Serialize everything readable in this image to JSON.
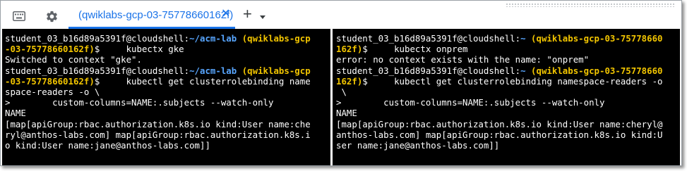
{
  "tabbar": {
    "tab_label": "(qwiklabs-gcp-03-75778660162f)",
    "tab_close": "✕",
    "add_tab": "+",
    "icons": [
      "keyboard-icon",
      "gear-icon",
      "close-icon",
      "plus-icon",
      "chevron-down-icon"
    ]
  },
  "colors": {
    "accent": "#1a73e8",
    "terminal_bg": "#000000",
    "path": "#58a6ff",
    "project": "#f2c500"
  },
  "left_pane": {
    "lines": [
      {
        "t1": "student_03_b16d89a5391f@cloudshell:",
        "path": "~/acm-lab",
        "proj": " (qwiklabs-gcp",
        "t2": ""
      },
      {
        "t1": "",
        "path": "",
        "proj": "-03-75778660162f)",
        "t2": "$     kubectx gke"
      },
      {
        "t1": "Switched to context \"gke\".",
        "path": "",
        "proj": "",
        "t2": ""
      },
      {
        "t1": "student_03_b16d89a5391f@cloudshell:",
        "path": "~/acm-lab",
        "proj": " (qwiklabs-gcp",
        "t2": ""
      },
      {
        "t1": "",
        "path": "",
        "proj": "-03-75778660162f)",
        "t2": "$     kubectl get clusterrolebinding name"
      },
      {
        "t1": "space-readers -o \\",
        "path": "",
        "proj": "",
        "t2": ""
      },
      {
        "t1": ">        custom-columns=NAME:.subjects --watch-only",
        "path": "",
        "proj": "",
        "t2": ""
      },
      {
        "t1": "NAME",
        "path": "",
        "proj": "",
        "t2": ""
      },
      {
        "t1": "[map[apiGroup:rbac.authorization.k8s.io kind:User name:che",
        "path": "",
        "proj": "",
        "t2": ""
      },
      {
        "t1": "ryl@anthos-labs.com] map[apiGroup:rbac.authorization.k8s.i",
        "path": "",
        "proj": "",
        "t2": ""
      },
      {
        "t1": "o kind:User name:jane@anthos-labs.com]]",
        "path": "",
        "proj": "",
        "t2": ""
      }
    ]
  },
  "right_pane": {
    "lines": [
      {
        "t1": "student_03_b16d89a5391f@cloudshell:",
        "path": "~",
        "proj": " (qwiklabs-gcp-03-75778660",
        "t2": ""
      },
      {
        "t1": "",
        "path": "",
        "proj": "162f)",
        "t2": "$     kubectx onprem"
      },
      {
        "t1": "error: no context exists with the name: \"onprem\"",
        "path": "",
        "proj": "",
        "t2": ""
      },
      {
        "t1": "student_03_b16d89a5391f@cloudshell:",
        "path": "~",
        "proj": " (qwiklabs-gcp-03-75778660",
        "t2": ""
      },
      {
        "t1": "",
        "path": "",
        "proj": "162f)",
        "t2": "$     kubectl get clusterrolebinding namespace-readers -o"
      },
      {
        "t1": " \\",
        "path": "",
        "proj": "",
        "t2": ""
      },
      {
        "t1": ">        custom-columns=NAME:.subjects --watch-only",
        "path": "",
        "proj": "",
        "t2": ""
      },
      {
        "t1": "NAME",
        "path": "",
        "proj": "",
        "t2": ""
      },
      {
        "t1": "[map[apiGroup:rbac.authorization.k8s.io kind:User name:cheryl@",
        "path": "",
        "proj": "",
        "t2": ""
      },
      {
        "t1": "anthos-labs.com] map[apiGroup:rbac.authorization.k8s.io kind:U",
        "path": "",
        "proj": "",
        "t2": ""
      },
      {
        "t1": "ser name:jane@anthos-labs.com]]",
        "path": "",
        "proj": "",
        "t2": ""
      }
    ]
  }
}
